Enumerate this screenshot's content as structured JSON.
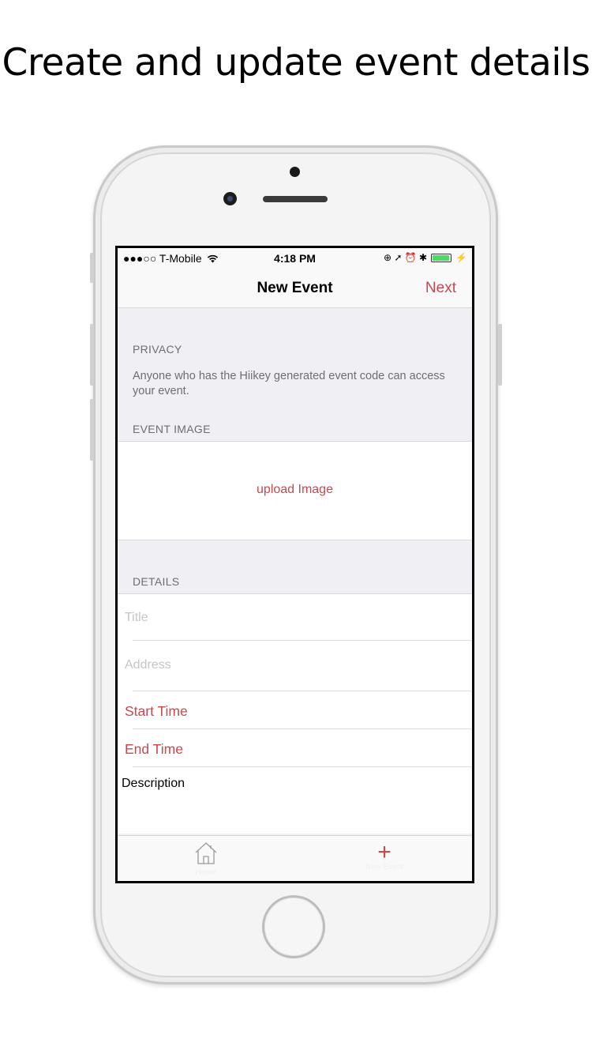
{
  "headline": "Create and update event details",
  "status_bar": {
    "carrier": "●●●○○ T-Mobile",
    "wifi_icon": "wifi-icon",
    "time": "4:18 PM",
    "indicators": "⊕ ➚ ⏰ ✱"
  },
  "nav": {
    "title": "New Event",
    "next_label": "Next"
  },
  "privacy": {
    "header": "PRIVACY",
    "text": "Anyone who has the Hiikey generated event code can access your event."
  },
  "event_image": {
    "header": "EVENT IMAGE",
    "upload_label": "upload Image"
  },
  "details": {
    "header": "DETAILS",
    "title_placeholder": "Title",
    "address_placeholder": "Address",
    "start_time_label": "Start Time",
    "end_time_label": "End Time",
    "description_label": "Description"
  },
  "tabbar": {
    "home_label": "Home",
    "new_event_label": "New Event"
  },
  "colors": {
    "accent": "#c8484d",
    "background": "#efeff4"
  }
}
